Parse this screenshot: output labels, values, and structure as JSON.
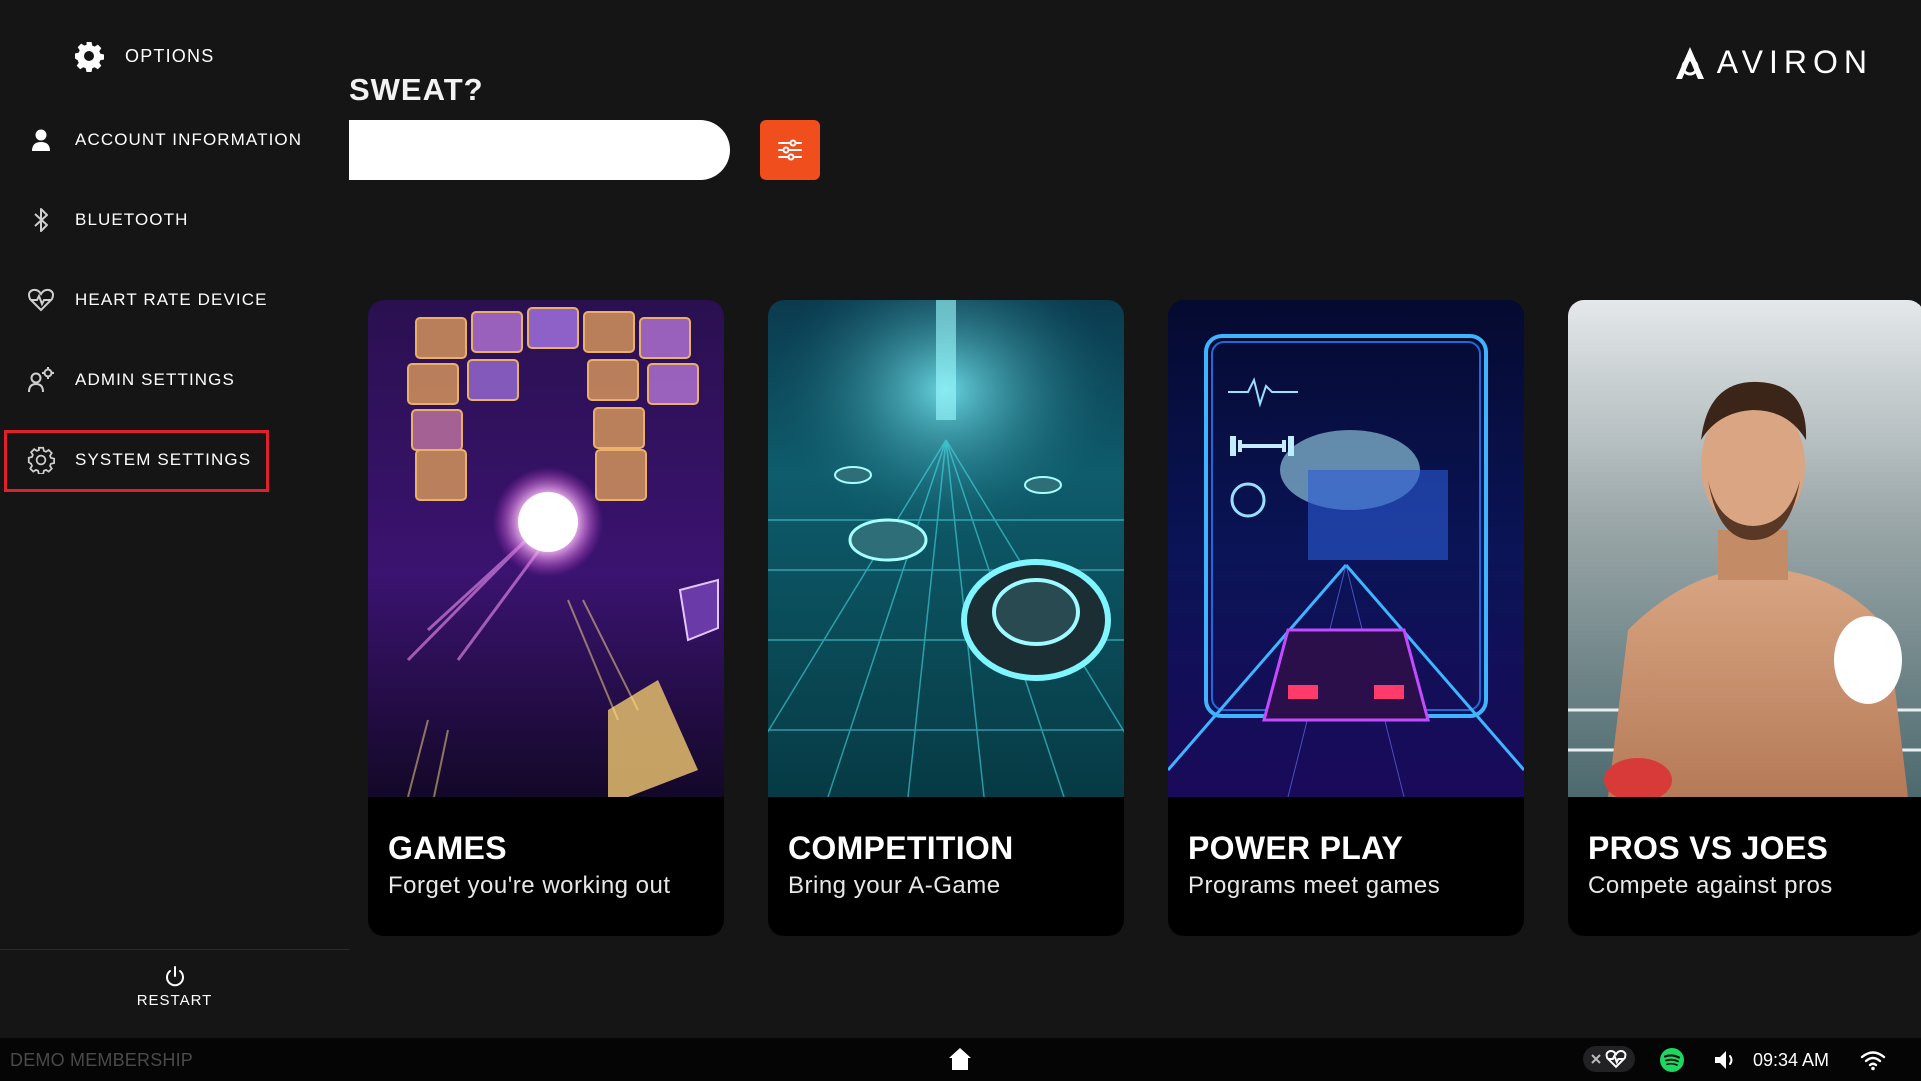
{
  "brand": {
    "name": "AVIRON"
  },
  "main": {
    "heading": "SWEAT?",
    "search": {
      "value": ""
    },
    "filter_icon": "sliders-icon"
  },
  "sidebar": {
    "header": {
      "icon": "gear-icon",
      "label": "OPTIONS"
    },
    "items": [
      {
        "label": "ACCOUNT INFORMATION",
        "icon": "person-icon"
      },
      {
        "label": "BLUETOOTH",
        "icon": "bluetooth-icon"
      },
      {
        "label": "HEART RATE DEVICE",
        "icon": "heart-rate-icon"
      },
      {
        "label": "ADMIN SETTINGS",
        "icon": "admin-gear-icon"
      },
      {
        "label": "SYSTEM SETTINGS",
        "icon": "settings-gear-icon",
        "highlighted": true
      }
    ],
    "restart": {
      "label": "RESTART",
      "icon": "power-icon"
    }
  },
  "cards": [
    {
      "title": "GAMES",
      "subtitle": "Forget you're working out"
    },
    {
      "title": "COMPETITION",
      "subtitle": "Bring your A-Game"
    },
    {
      "title": "POWER PLAY",
      "subtitle": "Programs meet games"
    },
    {
      "title": "PROS VS JOES",
      "subtitle": "Compete against pros"
    }
  ],
  "taskbar": {
    "membership": "DEMO MEMBERSHIP",
    "time": "09:34 AM",
    "icons": [
      "home-icon",
      "heart-rate-status-icon",
      "spotify-icon",
      "volume-icon",
      "wifi-icon"
    ]
  },
  "colors": {
    "accent": "#f04e1d",
    "highlight": "#e0202a",
    "background": "#151516"
  }
}
